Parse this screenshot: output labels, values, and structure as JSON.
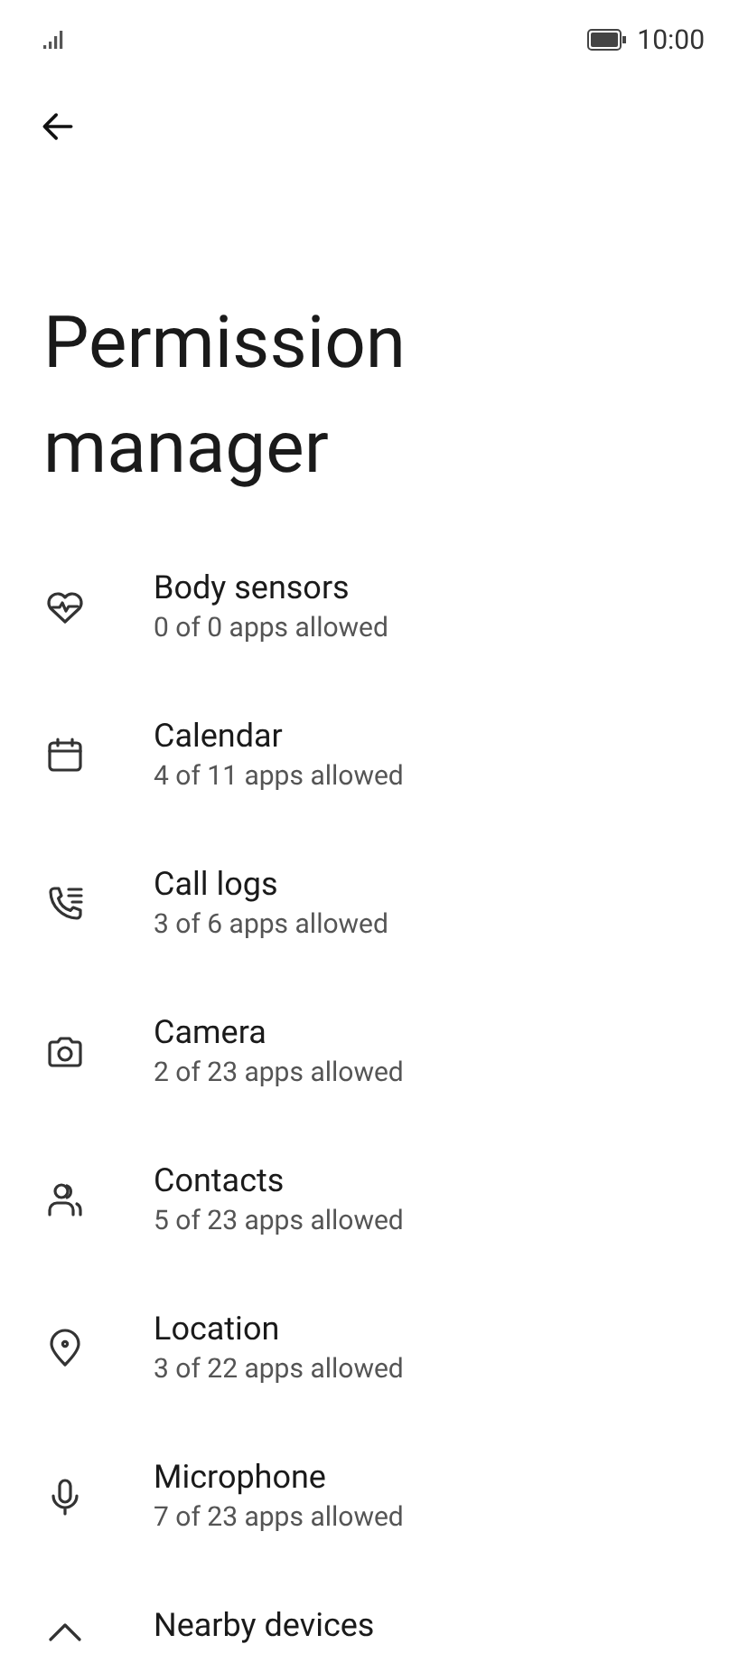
{
  "status_bar": {
    "time": "10:00"
  },
  "title": "Permission manager",
  "items": [
    {
      "kind": "heart",
      "label": "Body sensors",
      "subtitle": "0 of 0 apps allowed"
    },
    {
      "kind": "calendar",
      "label": "Calendar",
      "subtitle": "4 of 11 apps allowed"
    },
    {
      "kind": "call",
      "label": "Call logs",
      "subtitle": "3 of 6 apps allowed"
    },
    {
      "kind": "camera",
      "label": "Camera",
      "subtitle": "2 of 23 apps allowed"
    },
    {
      "kind": "people",
      "label": "Contacts",
      "subtitle": "5 of 23 apps allowed"
    },
    {
      "kind": "pin",
      "label": "Location",
      "subtitle": "3 of 22 apps allowed"
    },
    {
      "kind": "mic",
      "label": "Microphone",
      "subtitle": "7 of 23 apps allowed"
    },
    {
      "kind": "nearby",
      "label": "Nearby devices"
    }
  ]
}
